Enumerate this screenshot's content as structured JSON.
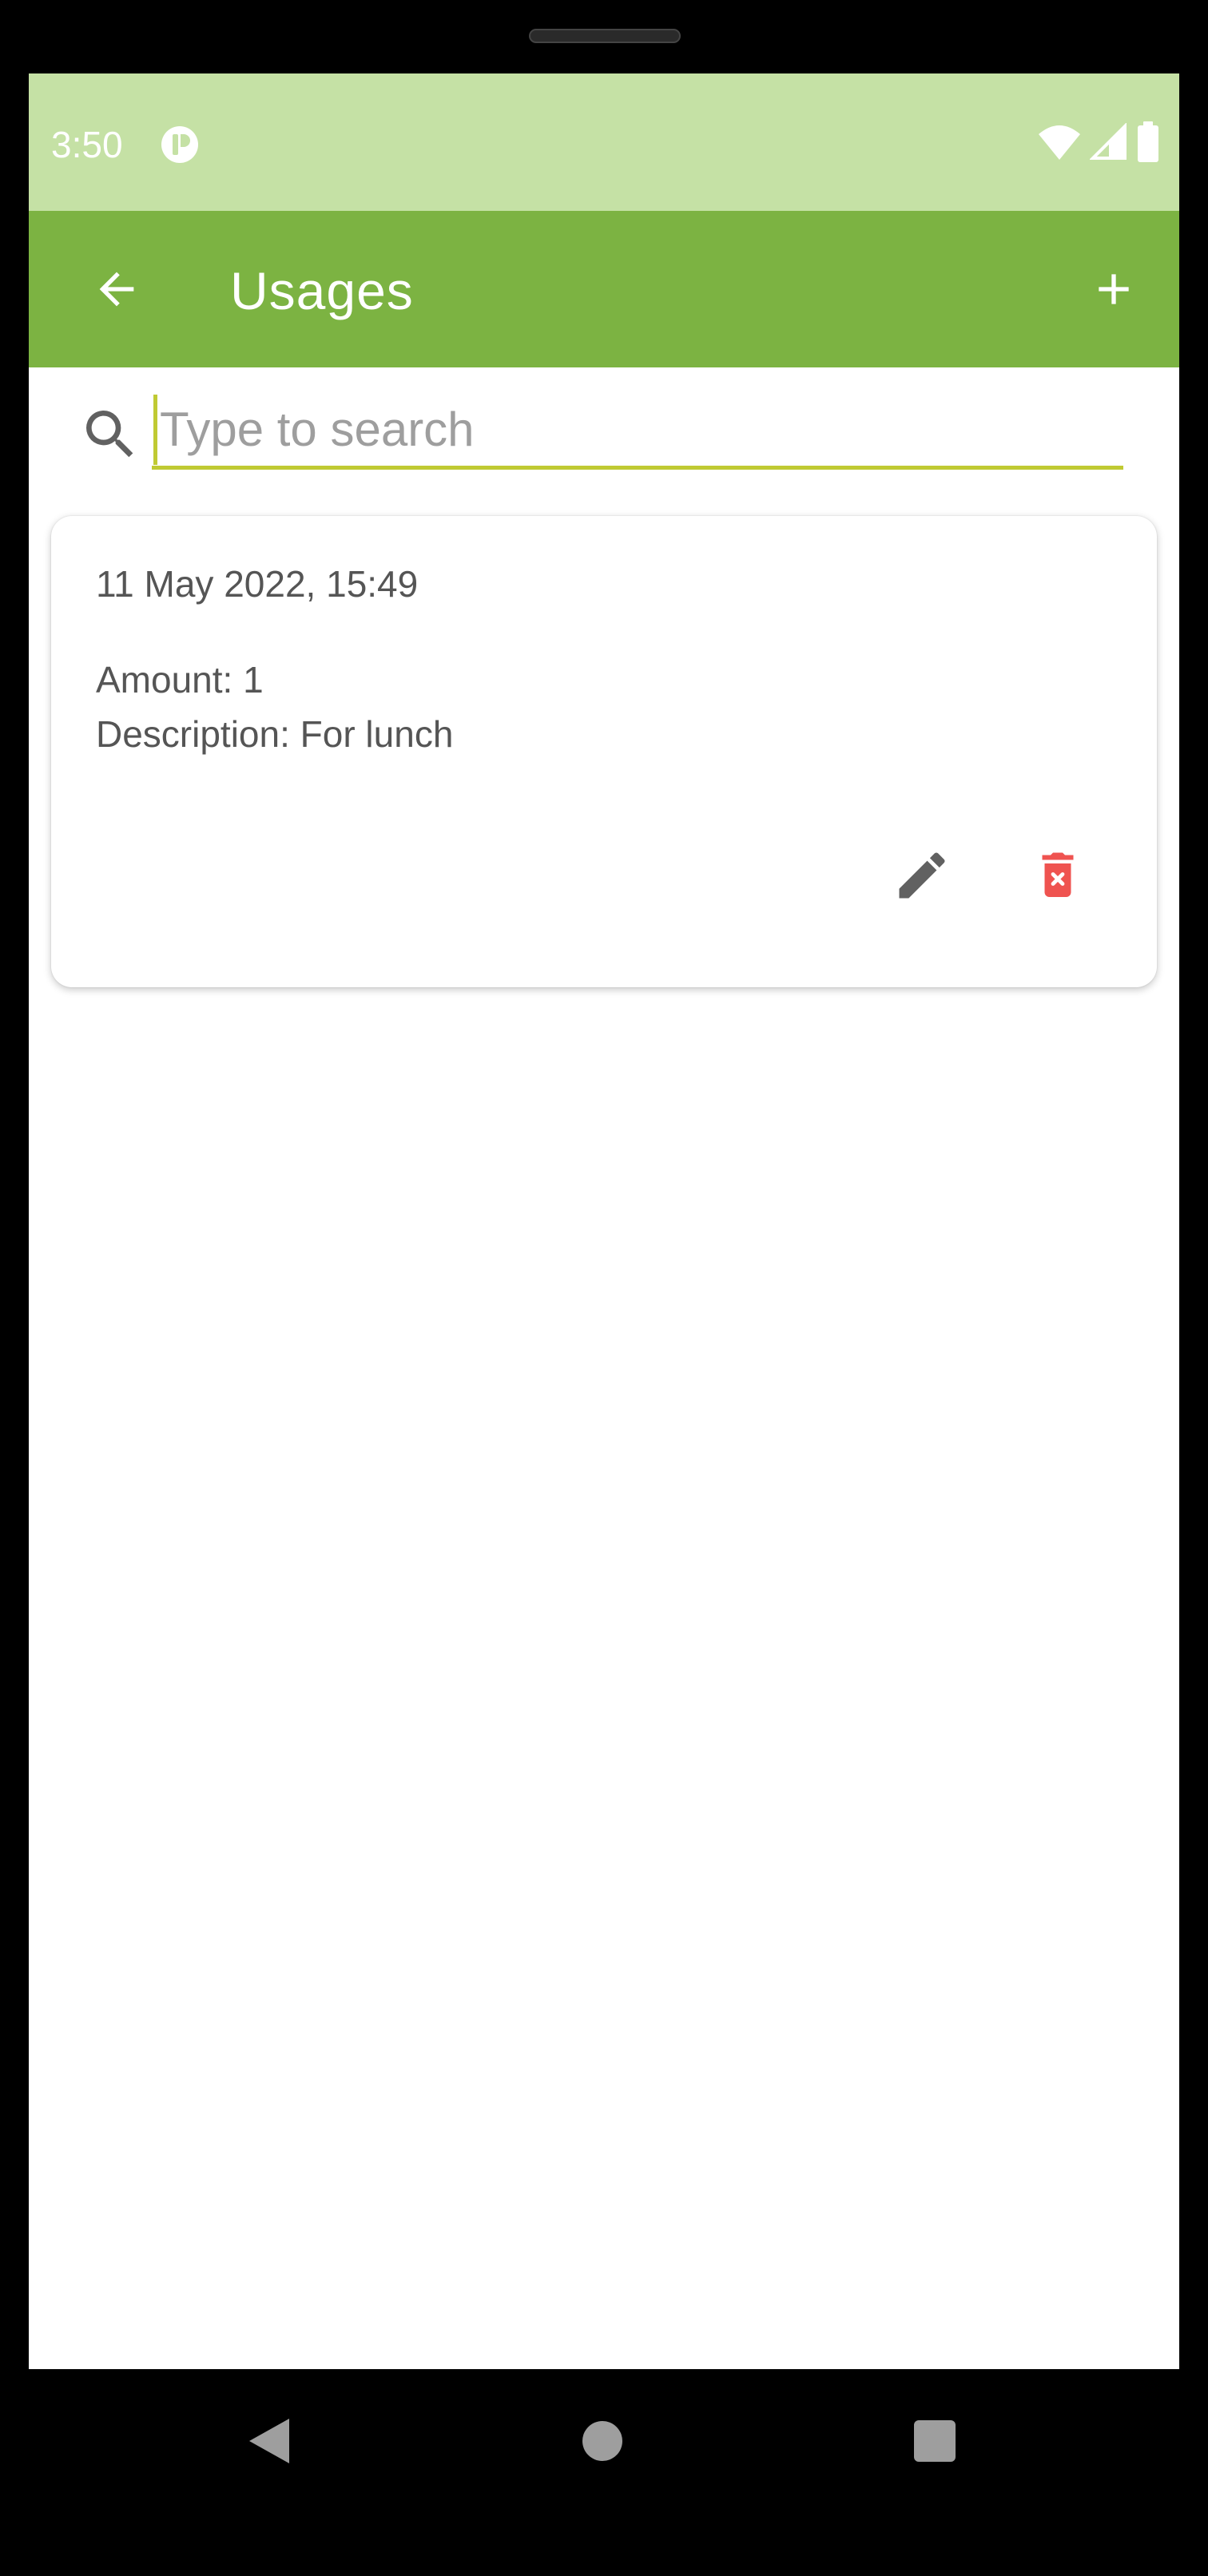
{
  "status_bar": {
    "time": "3:50",
    "icons": [
      "app-notification-icon",
      "wifi-icon",
      "cellular-signal-icon",
      "battery-icon"
    ]
  },
  "app_bar": {
    "title": "Usages",
    "back_icon": "arrow-back-icon",
    "add_icon": "plus-icon"
  },
  "search": {
    "placeholder": "Type to search",
    "value": ""
  },
  "usages": [
    {
      "date": "11 May 2022, 15:49",
      "amount": "Amount: 1",
      "description": "Description: For lunch",
      "edit_icon": "pencil-icon",
      "delete_icon": "trash-icon"
    }
  ],
  "navigation": {
    "back": "nav-back-icon",
    "home": "nav-home-icon",
    "recents": "nav-recents-icon"
  },
  "colors": {
    "status_bar": "#c5e1a5",
    "app_bar": "#7cb342",
    "accent": "#c0ca33",
    "delete": "#ef5350",
    "icon_gray": "#616161"
  }
}
